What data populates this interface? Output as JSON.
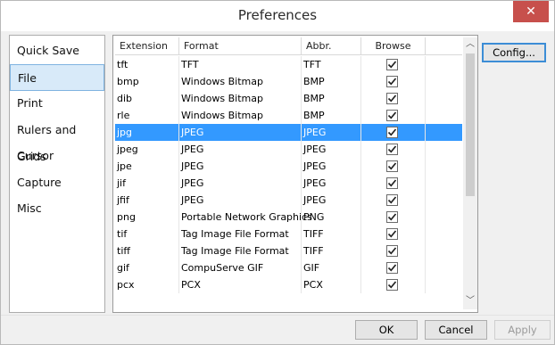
{
  "window": {
    "title": "Preferences",
    "close_glyph": "✕"
  },
  "sidebar": {
    "items": [
      {
        "label": "Quick Save",
        "selected": false
      },
      {
        "label": "File",
        "selected": true
      },
      {
        "label": "Print",
        "selected": false
      },
      {
        "label": "Rulers and Grids",
        "selected": false
      },
      {
        "label": "Cursor",
        "selected": false
      },
      {
        "label": "Capture",
        "selected": false
      },
      {
        "label": "Misc",
        "selected": false
      }
    ]
  },
  "table": {
    "headers": {
      "extension": "Extension",
      "format": "Format",
      "abbr": "Abbr.",
      "browse": "Browse"
    },
    "rows": [
      {
        "ext": "tft",
        "format": "TFT",
        "abbr": "TFT",
        "browse": true
      },
      {
        "ext": "bmp",
        "format": "Windows Bitmap",
        "abbr": "BMP",
        "browse": true
      },
      {
        "ext": "dib",
        "format": "Windows Bitmap",
        "abbr": "BMP",
        "browse": true
      },
      {
        "ext": "rle",
        "format": "Windows Bitmap",
        "abbr": "BMP",
        "browse": true
      },
      {
        "ext": "jpg",
        "format": "JPEG",
        "abbr": "JPEG",
        "browse": true,
        "selected": true
      },
      {
        "ext": "jpeg",
        "format": "JPEG",
        "abbr": "JPEG",
        "browse": true
      },
      {
        "ext": "jpe",
        "format": "JPEG",
        "abbr": "JPEG",
        "browse": true
      },
      {
        "ext": "jif",
        "format": "JPEG",
        "abbr": "JPEG",
        "browse": true
      },
      {
        "ext": "jfif",
        "format": "JPEG",
        "abbr": "JPEG",
        "browse": true
      },
      {
        "ext": "png",
        "format": "Portable Network Graphics",
        "abbr": "PNG",
        "browse": true
      },
      {
        "ext": "tif",
        "format": "Tag Image File Format",
        "abbr": "TIFF",
        "browse": true
      },
      {
        "ext": "tiff",
        "format": "Tag Image File Format",
        "abbr": "TIFF",
        "browse": true
      },
      {
        "ext": "gif",
        "format": "CompuServe GIF",
        "abbr": "GIF",
        "browse": true
      },
      {
        "ext": "pcx",
        "format": "PCX",
        "abbr": "PCX",
        "browse": true
      }
    ]
  },
  "buttons": {
    "config": "Config...",
    "ok": "OK",
    "cancel": "Cancel",
    "apply": "Apply"
  },
  "scroll": {
    "up_glyph": "︿",
    "down_glyph": "﹀"
  }
}
